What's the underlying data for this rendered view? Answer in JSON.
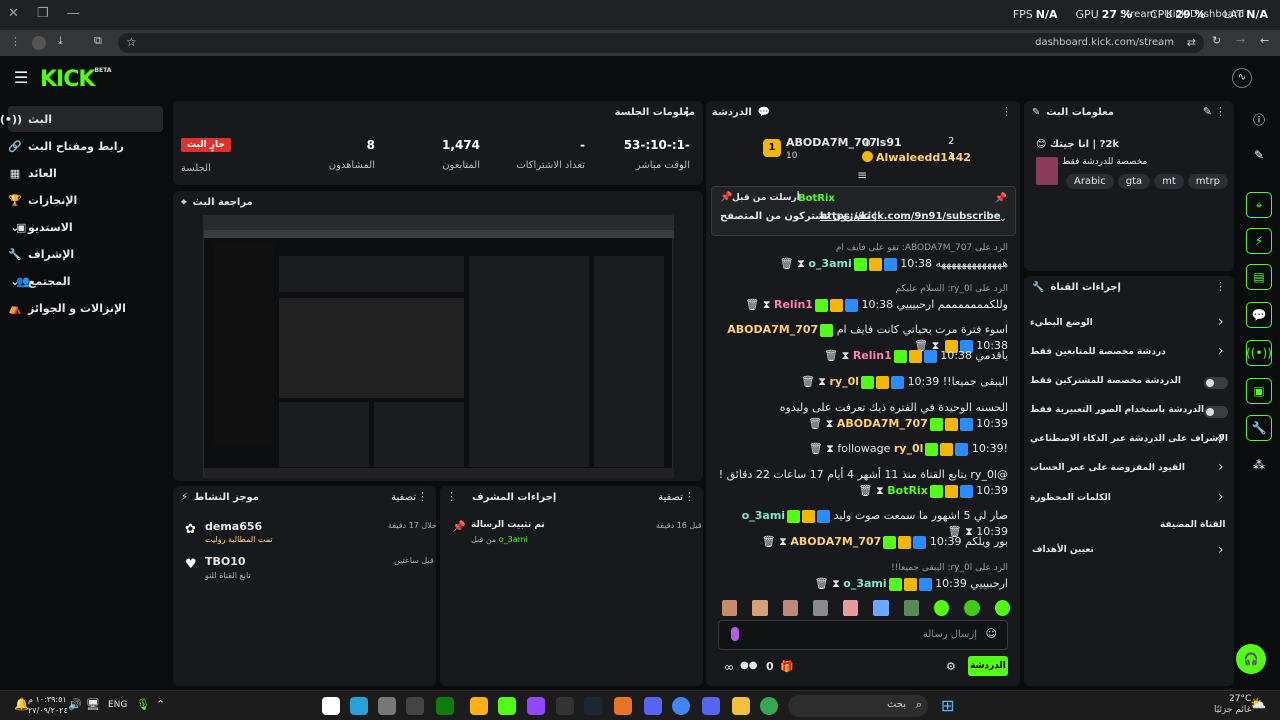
{
  "browser": {
    "url": "dashboard.kick.com/stream",
    "tab_title": "Stream - Kick Dashboard"
  },
  "overlay": {
    "fps_label": "FPS",
    "fps_value": "N/A",
    "gpu_label": "GPU",
    "gpu_value": "27 %",
    "cpu_label": "CPU",
    "cpu_value": "29 %",
    "lat_label": "LAT",
    "lat_value": "N/A"
  },
  "brand": {
    "logo": "KICK",
    "beta": "BETA"
  },
  "sidebar": {
    "items": [
      {
        "label": "البث",
        "icon": "broadcast-icon"
      },
      {
        "label": "رابط ومفتاح البث",
        "icon": "link-icon"
      },
      {
        "label": "العائد",
        "icon": "revenue-icon"
      },
      {
        "label": "الإنجازات",
        "icon": "trophy-icon"
      },
      {
        "label": "الاستديو",
        "icon": "studio-icon"
      },
      {
        "label": "الإشراف",
        "icon": "wrench-icon"
      },
      {
        "label": "المجتمع",
        "icon": "community-icon"
      },
      {
        "label": "الإنزالات و الجوائز",
        "icon": "drops-icon"
      }
    ]
  },
  "session": {
    "title": "معلومات الجلسة",
    "live_badge": "جارٍ البث",
    "session_label": "الجلسة",
    "stats": [
      {
        "value": "-1:-10:-53",
        "label": "الوقت مباشر"
      },
      {
        "value": "-",
        "label": "تعداد الاشتراكات"
      },
      {
        "value": "1,474",
        "label": "المتابعون"
      },
      {
        "value": "8",
        "label": "المشاهدون"
      }
    ]
  },
  "preview": {
    "title": "مراجعة البث"
  },
  "activity": {
    "title": "موجز النشاط",
    "filter": "تصفية",
    "items": [
      {
        "user": "dema656",
        "time": "خلال 17 دقيقة",
        "desc": "تمت المطالبة روليت"
      },
      {
        "user": "TBO10",
        "time": "قبل ساعتين",
        "desc": "تابع القناة للتو"
      }
    ]
  },
  "modactions": {
    "title": "إجراءات المشرف",
    "filter": "تصفية",
    "items": [
      {
        "title": "تم تثبيت الرسالة",
        "by": "من قبل",
        "user": "o_3ami",
        "time": "قبل 16 دقيقة"
      }
    ]
  },
  "chat": {
    "title": "الدردشة",
    "leaderboard": [
      {
        "rank": "1",
        "user": "ABODA7M_707",
        "count": "10"
      },
      {
        "rank": "2",
        "user": "ls91",
        "count": "2"
      },
      {
        "rank": "3",
        "user": "Alwaleedd1442",
        "count": "1"
      }
    ],
    "pinned": {
      "label": "أرسلت من قبل",
      "user": "BotRix",
      "text": "تقدرون تشتركون من المتصفح |",
      "link": "https://kick.com/9n91/subscribe"
    },
    "messages": [
      {
        "reply": "الرد على ABODA7M_707: تقو على فايف ام",
        "time": "10:38",
        "user": "o_3ami",
        "color": "#7ee8c8",
        "text": "هههههههههههههه"
      },
      {
        "reply": "الرد على ry_0l: السلام عليكم",
        "time": "10:38",
        "user": "Relin1",
        "color": "#ff7fb0",
        "text": "وللكمممممممم ارحبيييي"
      },
      {
        "reply": "",
        "time": "10:38",
        "user": "ABODA7M_707",
        "color": "#ffd166",
        "text": "اسوء فترة مرت بحياتي كانت فايف ام"
      },
      {
        "reply": "",
        "time": "10:38",
        "user": "Relin1",
        "color": "#ff7fb0",
        "text": "ياقدمي"
      },
      {
        "reply": "",
        "time": "10:39",
        "user": "ry_0l",
        "color": "#ffd166",
        "text": "اليبقى جميعا!!"
      },
      {
        "reply": "",
        "time": "10:39",
        "user": "ABODA7M_707",
        "color": "#ffd166",
        "text": "الحسنه الوحيدة في الفتره ذيك تعرفت على وليدوه"
      },
      {
        "reply": "",
        "time": "10:39",
        "user": "ry_0l",
        "color": "#ffd166",
        "text": "!followage"
      },
      {
        "reply": "",
        "time": "10:39",
        "user": "BotRix",
        "color": "#53fc18",
        "text": "@ry_0l يتابع القناة منذ 11 أشهر 4 أيام 17 ساعات 22 دقائق !"
      },
      {
        "reply": "",
        "time": "10:39",
        "user": "o_3ami",
        "color": "#7ee8c8",
        "text": "صار لي 5 اشهور ما سمعت صوت وليد"
      },
      {
        "reply": "",
        "time": "10:39",
        "user": "ABODA7M_707",
        "color": "#ffd166",
        "text": "بور ويلكم"
      },
      {
        "reply": "الرد على ry_0l: اليبقى جميعا!!",
        "time": "10:39",
        "user": "o_3ami",
        "color": "#7ee8c8",
        "text": "ارحبيييي"
      }
    ],
    "input_placeholder": "إرسال رسالة",
    "send_label": "الدردشة",
    "viewer_count": "0"
  },
  "streaminfo": {
    "title": "معلومات البث",
    "stream_title": "2k? | انا جيتك 😊",
    "category": "مخصصة للدردشة فقط",
    "tags": [
      "Arabic",
      "gta",
      "mt",
      "mtrp"
    ]
  },
  "channelactions": {
    "title": "إجراءات القناة",
    "rows": [
      {
        "label": "الوضع البطيء",
        "control": "chevron"
      },
      {
        "label": "دردشة مخصصة للمتابعين فقط",
        "control": "chevron"
      },
      {
        "label": "الدردشة مخصصة للمشتركين فقط",
        "control": "toggle"
      },
      {
        "label": "الدردشة باستخدام الصور التعبيرية فقط",
        "control": "toggle"
      },
      {
        "label": "الإشراف على الدردشة عبر الذكاء الاصطناعي",
        "control": "external"
      },
      {
        "label": "القيود المفروضة على عمر الحساب",
        "control": "chevron"
      },
      {
        "label": "الكلمات المحظورة",
        "control": "chevron"
      }
    ],
    "featured_label": "القناة المضيفة",
    "goals_label": "تعيين الأهداف"
  },
  "taskbar": {
    "time": "١٠:٣٩:٥١ م",
    "date": "٢٧/٠٩/٢٠٢٤",
    "lang": "ENG",
    "search_placeholder": "بحث",
    "weather_temp": "27°C",
    "weather_desc": "غائم جزئيًا"
  }
}
